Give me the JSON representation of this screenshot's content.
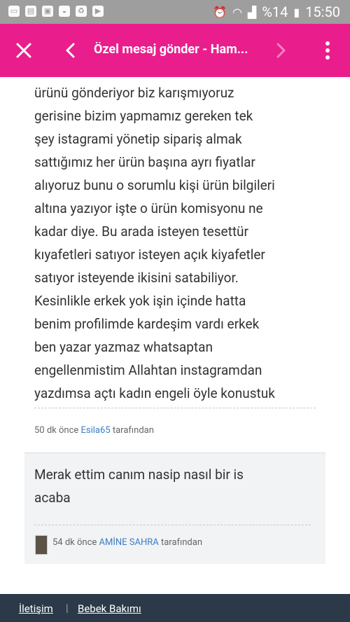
{
  "status_bar": {
    "left_icons": [
      "cast-icon",
      "sim-icon",
      "image-icon",
      "incognito-icon",
      "recycle-icon",
      "youtube-icon"
    ],
    "battery": "%14",
    "time": "15:50"
  },
  "app_bar": {
    "title": "Özel mesaj gönder - Ham...",
    "color": "#e91e8c"
  },
  "message1": {
    "lines": [
      "ürünü gönderiyor biz karışmıyoruz",
      "gerisine bizim yapmamız gereken tek",
      "şey istagrami yönetip sipariş almak",
      "sattığımız her ürün başına ayrı fiyatlar",
      "alıyoruz bunu o sorumlu kişi ürün bilgileri",
      "altına yazıyor işte o ürün komisyonu ne",
      "kadar diye. Bu arada isteyen tesettür",
      "kıyafetleri satıyor isteyen açık kiyafetler",
      "satıyor isteyende ikisini satabiliyor.",
      "Kesinlikle erkek yok işin içinde hatta",
      "benim profilimde kardeşim vardı erkek",
      "ben yazar yazmaz whatsaptan",
      "engellenmistim Allahtan instagramdan",
      "yazdımsa açtı kadın engeli öyle konustuk"
    ],
    "meta_prefix": "50 dk önce",
    "author": "Esila65",
    "meta_suffix": "tarafından"
  },
  "message2": {
    "lines": [
      "Merak ettim canım nasip nasıl bir is",
      "acaba"
    ],
    "meta_prefix": "54 dk önce",
    "author": "AMİNE SAHRA",
    "meta_suffix": "tarafından"
  },
  "footer": {
    "link1": "İletişim",
    "separator": "|",
    "link2": "Bebek Bakımı"
  }
}
